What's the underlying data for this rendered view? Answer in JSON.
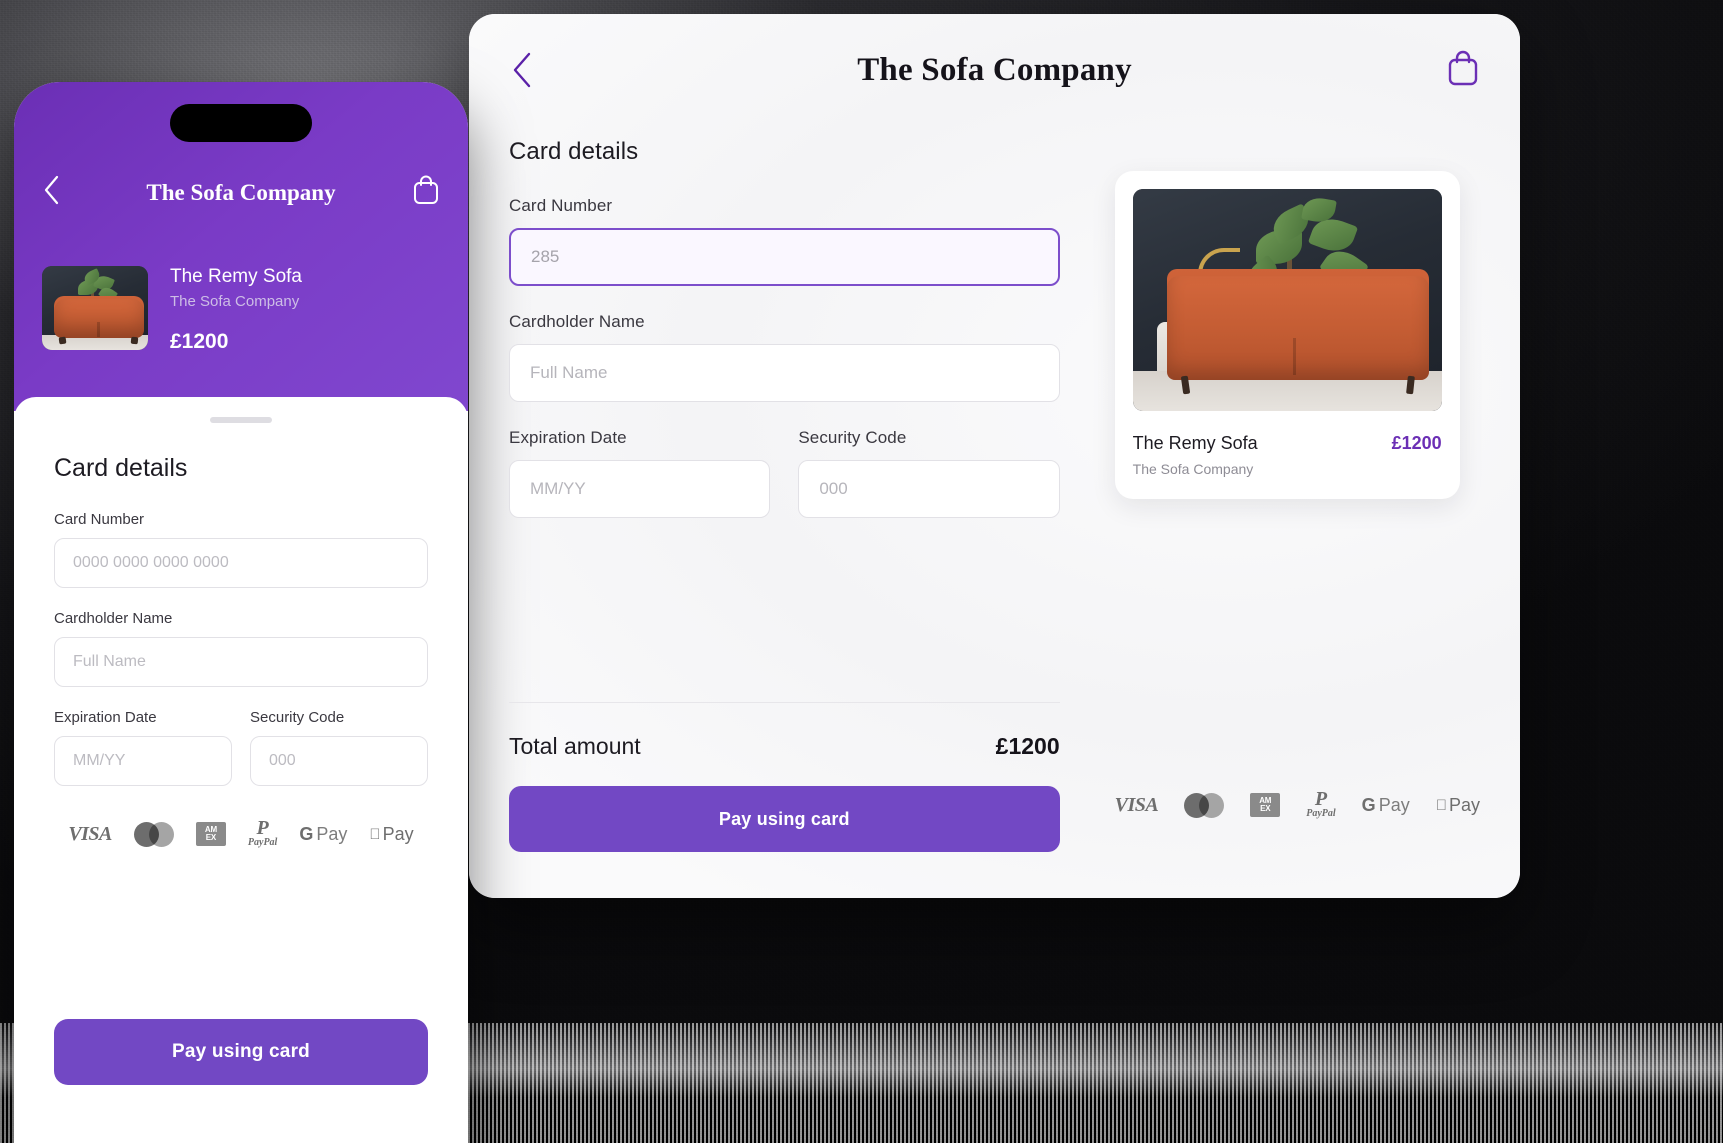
{
  "brand": {
    "name": "The Sofa Company",
    "accent": "#7248c4",
    "header_purple": "#6b2fb5",
    "price_purple": "#6b2fb5"
  },
  "phone": {
    "title": "The Sofa Company",
    "back_icon": "chevron-left-icon",
    "bag_icon": "shopping-bag-icon",
    "product": {
      "name": "The Remy Sofa",
      "vendor": "The Sofa Company",
      "price": "£1200"
    },
    "sheet": {
      "title": "Card details",
      "fields": [
        {
          "label": "Card Number",
          "placeholder": "0000 0000 0000 0000",
          "value": ""
        },
        {
          "label": "Cardholder Name",
          "placeholder": "Full Name",
          "value": ""
        },
        {
          "label": "Expiration Date",
          "placeholder": "MM/YY",
          "value": ""
        },
        {
          "label": "Security Code",
          "placeholder": "000",
          "value": ""
        }
      ]
    },
    "pay_button": "Pay using card"
  },
  "desktop": {
    "title": "The Sofa Company",
    "back_icon": "chevron-left-icon",
    "bag_icon": "shopping-bag-icon",
    "form": {
      "title": "Card details",
      "card_number": {
        "label": "Card Number",
        "placeholder": "0000 0000 0000 0000",
        "value": "285",
        "focused": true
      },
      "cardholder": {
        "label": "Cardholder Name",
        "placeholder": "Full Name",
        "value": ""
      },
      "expiration": {
        "label": "Expiration Date",
        "placeholder": "MM/YY",
        "value": ""
      },
      "security": {
        "label": "Security Code",
        "placeholder": "000",
        "value": ""
      }
    },
    "total": {
      "label": "Total amount",
      "value": "£1200"
    },
    "pay_button": "Pay using card",
    "product": {
      "name": "The Remy Sofa",
      "vendor": "The Sofa Company",
      "price": "£1200"
    }
  },
  "payment_methods": [
    {
      "id": "visa-icon",
      "label": "VISA"
    },
    {
      "id": "mastercard-icon",
      "label": "Mastercard"
    },
    {
      "id": "amex-icon",
      "label": "AMEX",
      "line1": "AM",
      "line2": "EX"
    },
    {
      "id": "paypal-icon",
      "label": "PayPal",
      "glyph": "P",
      "word": "PayPal"
    },
    {
      "id": "google-pay-icon",
      "label": "G Pay",
      "g": "G",
      "pay": "Pay"
    },
    {
      "id": "apple-pay-icon",
      "label": "Apple Pay",
      "apple": "",
      "pay": "Pay"
    }
  ]
}
